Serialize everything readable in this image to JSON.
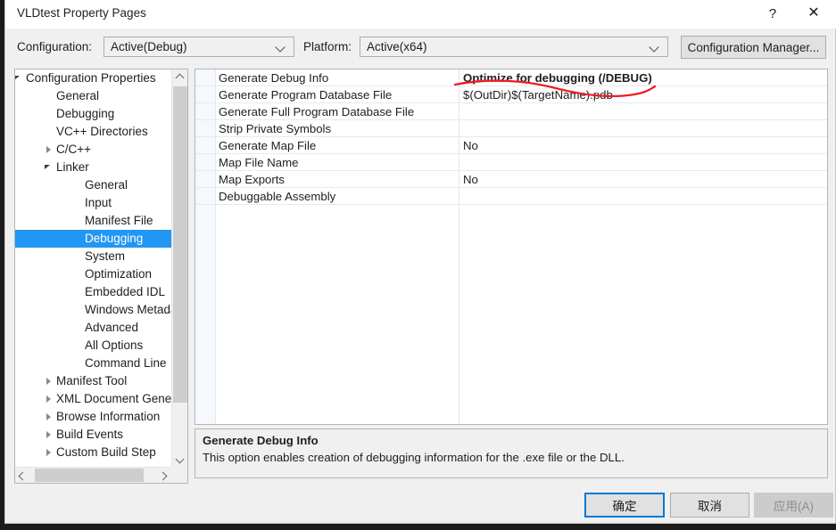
{
  "window": {
    "title": "VLDtest Property Pages",
    "help_glyph": "?",
    "close_glyph": "✕"
  },
  "config_bar": {
    "configuration_label": "Configuration:",
    "configuration_value": "Active(Debug)",
    "platform_label": "Platform:",
    "platform_value": "Active(x64)",
    "configuration_manager_label": "Configuration Manager..."
  },
  "tree": {
    "items": [
      {
        "label": "Configuration Properties",
        "indent": 12,
        "arrow": "expanded",
        "selected": false
      },
      {
        "label": "General",
        "indent": 46,
        "arrow": "none",
        "selected": false
      },
      {
        "label": "Debugging",
        "indent": 46,
        "arrow": "none",
        "selected": false
      },
      {
        "label": "VC++ Directories",
        "indent": 46,
        "arrow": "none",
        "selected": false
      },
      {
        "label": "C/C++",
        "indent": 46,
        "arrow": "collapsed",
        "selected": false
      },
      {
        "label": "Linker",
        "indent": 46,
        "arrow": "expanded",
        "selected": false
      },
      {
        "label": "General",
        "indent": 78,
        "arrow": "none",
        "selected": false
      },
      {
        "label": "Input",
        "indent": 78,
        "arrow": "none",
        "selected": false
      },
      {
        "label": "Manifest File",
        "indent": 78,
        "arrow": "none",
        "selected": false
      },
      {
        "label": "Debugging",
        "indent": 78,
        "arrow": "none",
        "selected": true
      },
      {
        "label": "System",
        "indent": 78,
        "arrow": "none",
        "selected": false
      },
      {
        "label": "Optimization",
        "indent": 78,
        "arrow": "none",
        "selected": false
      },
      {
        "label": "Embedded IDL",
        "indent": 78,
        "arrow": "none",
        "selected": false
      },
      {
        "label": "Windows Metadata",
        "indent": 78,
        "arrow": "none",
        "selected": false
      },
      {
        "label": "Advanced",
        "indent": 78,
        "arrow": "none",
        "selected": false
      },
      {
        "label": "All Options",
        "indent": 78,
        "arrow": "none",
        "selected": false
      },
      {
        "label": "Command Line",
        "indent": 78,
        "arrow": "none",
        "selected": false
      },
      {
        "label": "Manifest Tool",
        "indent": 46,
        "arrow": "collapsed",
        "selected": false
      },
      {
        "label": "XML Document Generator",
        "indent": 46,
        "arrow": "collapsed",
        "selected": false
      },
      {
        "label": "Browse Information",
        "indent": 46,
        "arrow": "collapsed",
        "selected": false
      },
      {
        "label": "Build Events",
        "indent": 46,
        "arrow": "collapsed",
        "selected": false
      },
      {
        "label": "Custom Build Step",
        "indent": 46,
        "arrow": "collapsed",
        "selected": false
      }
    ]
  },
  "grid": {
    "rows": [
      {
        "name": "Generate Debug Info",
        "value": "Optimize for debugging (/DEBUG)",
        "bold": true
      },
      {
        "name": "Generate Program Database File",
        "value": "$(OutDir)$(TargetName).pdb",
        "bold": false
      },
      {
        "name": "Generate Full Program Database File",
        "value": "",
        "bold": false
      },
      {
        "name": "Strip Private Symbols",
        "value": "",
        "bold": false
      },
      {
        "name": "Generate Map File",
        "value": "No",
        "bold": false
      },
      {
        "name": "Map File Name",
        "value": "",
        "bold": false
      },
      {
        "name": "Map Exports",
        "value": "No",
        "bold": false
      },
      {
        "name": "Debuggable Assembly",
        "value": "",
        "bold": false
      }
    ]
  },
  "description": {
    "title": "Generate Debug Info",
    "body": "This option enables creation of debugging information for the .exe file or the DLL."
  },
  "footer": {
    "ok_label": "确定",
    "cancel_label": "取消",
    "apply_label": "应用(A)"
  },
  "colors": {
    "selection": "#2196f3",
    "focus_border": "#0078d7",
    "annotation": "#ee1c24",
    "dialog_bg": "#f0f0f0"
  }
}
